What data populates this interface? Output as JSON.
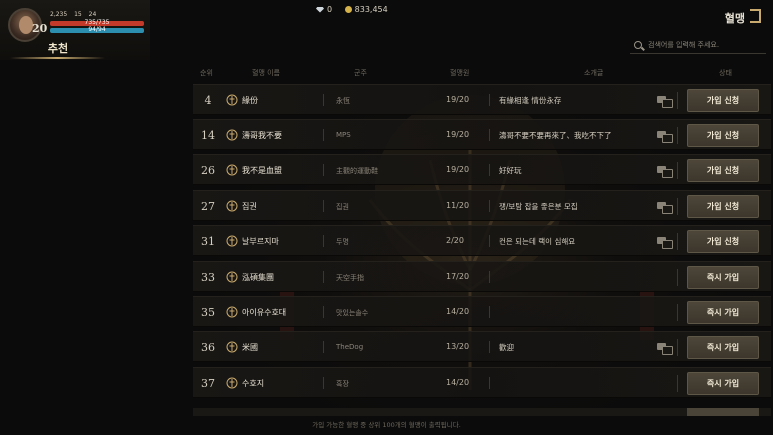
{
  "player": {
    "level": "20",
    "stat1": "2,235",
    "stat2": "15",
    "stat3": "24",
    "hp": "735/735",
    "mp": "94/94",
    "tab_label": "추천"
  },
  "currency": {
    "diamond": "0",
    "gold": "833,454"
  },
  "title": "혈맹",
  "search": {
    "placeholder": "검색어를 입력해 주세요."
  },
  "columns": [
    "순위",
    "혈맹 이름",
    "군주",
    "혈맹원",
    "소개글",
    "상태"
  ],
  "rows": [
    {
      "rank": "4",
      "name": "緣份",
      "leader": "永恆",
      "members": "19/20",
      "intro": "有緣相逢 情份永存",
      "chat": true,
      "button": "가입 신청"
    },
    {
      "rank": "14",
      "name": "濤哥我不要",
      "leader": "MPS",
      "members": "19/20",
      "intro": "濤哥不要不要再來了、我吃不下了",
      "chat": true,
      "button": "가입 신청"
    },
    {
      "rank": "26",
      "name": "我不是血盟",
      "leader": "主觀的運動鞋",
      "members": "19/20",
      "intro": "好好玩",
      "chat": true,
      "button": "가입 신청"
    },
    {
      "rank": "27",
      "name": "집권",
      "leader": "집권",
      "members": "11/20",
      "intro": "쟁/보탐 잡을 좋은분 모집",
      "chat": true,
      "button": "가입 신청"
    },
    {
      "rank": "31",
      "name": "날부르지마",
      "leader": "두명",
      "members": "2/20",
      "intro": "컨은 되는데 랙이 심해요",
      "chat": true,
      "button": "가입 신청"
    },
    {
      "rank": "33",
      "name": "泓碩集團",
      "leader": "天空手指",
      "members": "17/20",
      "intro": "",
      "chat": false,
      "button": "즉시 가입"
    },
    {
      "rank": "35",
      "name": "아이유수호대",
      "leader": "맛있는솔수",
      "members": "14/20",
      "intro": "",
      "chat": false,
      "button": "즉시 가입"
    },
    {
      "rank": "36",
      "name": "米國",
      "leader": "TheDog",
      "members": "13/20",
      "intro": "歡迎",
      "chat": true,
      "button": "즉시 가입"
    },
    {
      "rank": "37",
      "name": "수호지",
      "leader": "흑장",
      "members": "14/20",
      "intro": "",
      "chat": false,
      "button": "즉시 가입"
    }
  ],
  "footer_note": "가입 가능한 혈맹 중 상위 100개의 혈맹이 출력됩니다."
}
